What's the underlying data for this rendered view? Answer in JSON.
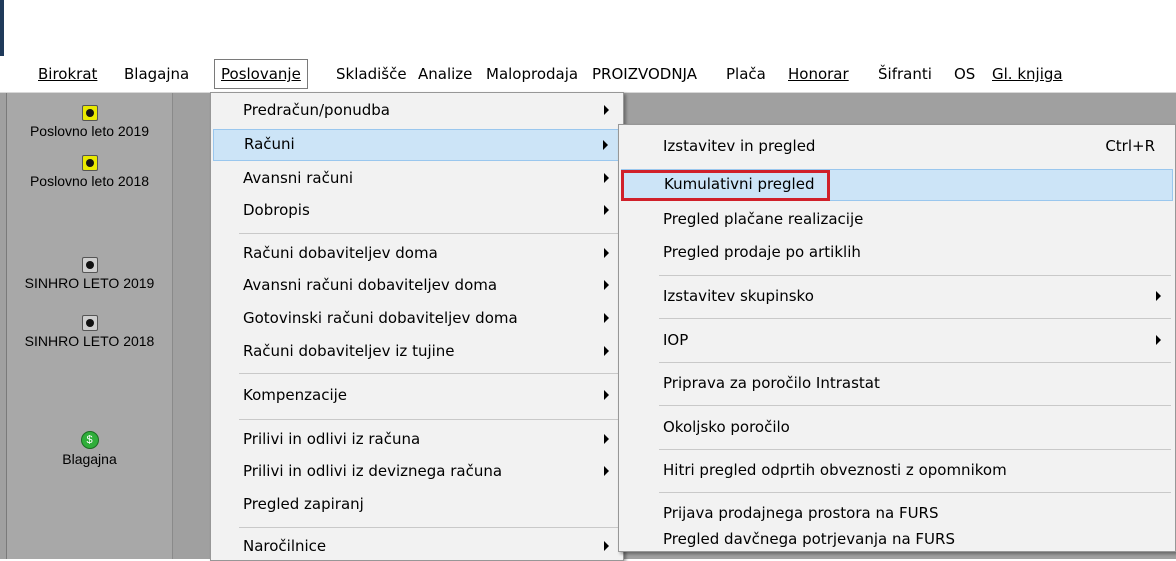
{
  "menubar": {
    "items": [
      "Birokrat",
      "Blagajna",
      "Poslovanje",
      "Skladišče",
      "Analize",
      "Maloprodaja",
      "PROIZVODNJA",
      "Plača",
      "Honorar",
      "Šifranti",
      "OS",
      "Gl. knjiga"
    ]
  },
  "left_panel": {
    "items": [
      {
        "label": "Poslovno leto 2019",
        "icon": "eye-icon"
      },
      {
        "label": "Poslovno leto 2018",
        "icon": "eye-icon"
      },
      {
        "label": "SINHRO LETO 2019",
        "icon": "eye-icon"
      },
      {
        "label": "SINHRO LETO 2018",
        "icon": "eye-icon"
      },
      {
        "label": "Blagajna",
        "icon": "money-icon"
      }
    ]
  },
  "poslovanje_menu": {
    "items": [
      "Predračun/ponudba",
      "Računi",
      "Avansni računi",
      "Dobropis",
      "Računi dobaviteljev doma",
      "Avansni računi dobaviteljev doma",
      "Gotovinski računi dobaviteljev doma",
      "Računi dobaviteljev iz tujine",
      "Kompenzacije",
      "Prilivi in odlivi iz računa",
      "Prilivi in odlivi iz deviznega računa",
      "Pregled zapiranj",
      "Naročilnice"
    ]
  },
  "racuni_menu": {
    "items": [
      "Izstavitev in pregled",
      "Kumulativni pregled",
      "Pregled plačane realizacije",
      "Pregled prodaje po artiklih",
      "Izstavitev skupinsko",
      "IOP",
      "Priprava za poročilo Intrastat",
      "Okoljsko poročilo",
      "Hitri pregled odprtih obveznosti z opomnikom",
      "Prijava prodajnega prostora na FURS",
      "Pregled davčnega potrjevanja na FURS"
    ],
    "shortcut": "Ctrl+R"
  },
  "colors": {
    "highlight": "#cce4f7",
    "annotation_box": "#d0202a"
  }
}
